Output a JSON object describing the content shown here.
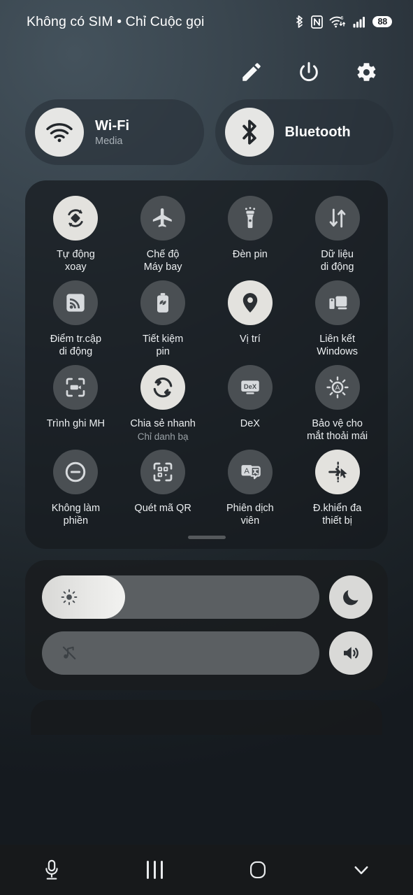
{
  "statusbar": {
    "carrier_primary": "Không có SIM • Chỉ Cuộc gọi",
    "battery_percent": "88",
    "icons": [
      "bluetooth-icon",
      "nfc-icon",
      "wifi-6-icon",
      "signal-bars-icon",
      "battery-icon"
    ]
  },
  "top_actions": [
    {
      "name": "edit-button",
      "icon": "pencil-icon"
    },
    {
      "name": "power-button",
      "icon": "power-icon"
    },
    {
      "name": "settings-button",
      "icon": "gear-icon"
    }
  ],
  "connectivity": [
    {
      "title": "Wi-Fi",
      "subtitle": "Media",
      "icon": "wifi-icon",
      "state": "on"
    },
    {
      "title": "Bluetooth",
      "subtitle": "",
      "icon": "bluetooth-icon",
      "state": "on"
    }
  ],
  "tiles": [
    {
      "label": "Tự động\nxoay",
      "sub": "",
      "icon": "auto-rotate-icon",
      "state": "on"
    },
    {
      "label": "Chế độ\nMáy bay",
      "sub": "",
      "icon": "airplane-icon",
      "state": "off"
    },
    {
      "label": "Đèn pin",
      "sub": "",
      "icon": "flashlight-icon",
      "state": "off"
    },
    {
      "label": "Dữ liệu\ndi động",
      "sub": "",
      "icon": "mobile-data-icon",
      "state": "off"
    },
    {
      "label": "Điểm tr.cập\ndi động",
      "sub": "",
      "icon": "hotspot-icon",
      "state": "off"
    },
    {
      "label": "Tiết kiệm\npin",
      "sub": "",
      "icon": "battery-saver-icon",
      "state": "off"
    },
    {
      "label": "Vị trí",
      "sub": "",
      "icon": "location-pin-icon",
      "state": "on"
    },
    {
      "label": "Liên kết\nWindows",
      "sub": "",
      "icon": "link-windows-icon",
      "state": "off"
    },
    {
      "label": "Trình ghi MH",
      "sub": "",
      "icon": "screen-recorder-icon",
      "state": "off"
    },
    {
      "label": "Chia sẻ nhanh",
      "sub": "Chỉ danh bạ",
      "icon": "quick-share-icon",
      "state": "on"
    },
    {
      "label": "DeX",
      "sub": "",
      "icon": "dex-icon",
      "state": "off"
    },
    {
      "label": "Bảo vệ cho\nmắt thoải mái",
      "sub": "",
      "icon": "eye-comfort-icon",
      "state": "off"
    },
    {
      "label": "Không làm\nphiền",
      "sub": "",
      "icon": "do-not-disturb-icon",
      "state": "off"
    },
    {
      "label": "Quét mã QR",
      "sub": "",
      "icon": "qr-scan-icon",
      "state": "off"
    },
    {
      "label": "Phiên dịch\nviên",
      "sub": "",
      "icon": "interpreter-icon",
      "state": "off"
    },
    {
      "label": "Đ.khiển đa\nthiết bị",
      "sub": "",
      "icon": "multi-control-icon",
      "state": "on"
    }
  ],
  "sliders": [
    {
      "name": "brightness-slider",
      "icon": "brightness-icon",
      "value_percent": 30,
      "side_button": {
        "name": "dark-mode-button",
        "icon": "moon-icon"
      }
    },
    {
      "name": "volume-slider",
      "icon": "music-muted-icon",
      "value_percent": 0,
      "side_button": {
        "name": "sound-mode-button",
        "icon": "speaker-icon"
      }
    }
  ],
  "navbar": [
    {
      "name": "voice-assistant-button",
      "icon": "microphone-icon"
    },
    {
      "name": "recents-button",
      "icon": "recents-icon"
    },
    {
      "name": "home-button",
      "icon": "home-icon"
    },
    {
      "name": "collapse-button",
      "icon": "chevron-down-icon"
    }
  ],
  "colors": {
    "accent_on": "#e3e2de",
    "tile_off": "#4a4f53",
    "panel": "#161a1e",
    "text": "#eceff1"
  }
}
